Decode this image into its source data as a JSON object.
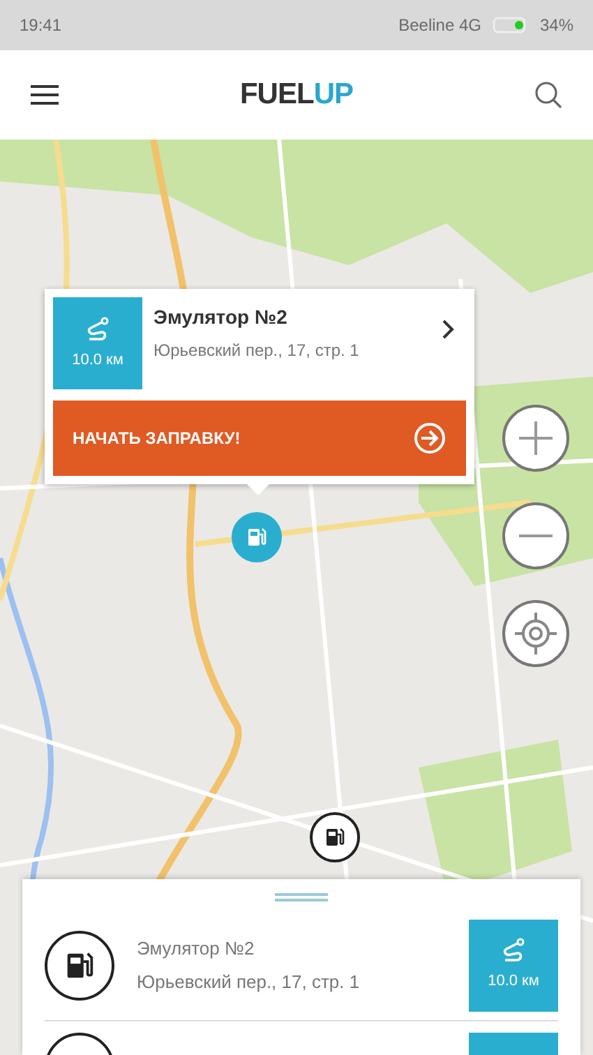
{
  "status_bar": {
    "time": "19:41",
    "carrier": "Beeline 4G",
    "battery": "34%"
  },
  "app_bar": {
    "title": "FUEL",
    "title_accent": "UP"
  },
  "map_markers": [
    {
      "selected": true
    },
    {
      "selected": false
    }
  ],
  "popup": {
    "name": "Эмулятор №2",
    "address": "Юрьевский пер., 17, стр. 1",
    "distance": "10.0 км",
    "action": "НАЧАТЬ ЗАПРАВКУ!"
  },
  "stations": [
    {
      "name": "Эмулятор №2",
      "address": "Юрьевский пер., 17, стр. 1",
      "distance": "10.0 км"
    }
  ]
}
